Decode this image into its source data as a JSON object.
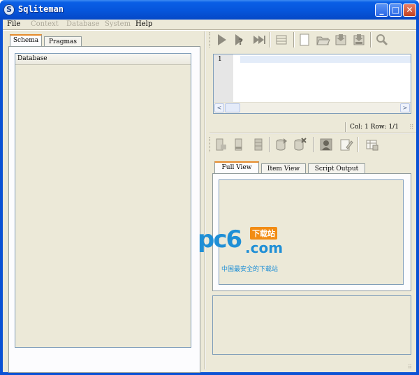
{
  "window": {
    "title": "Sqliteman",
    "icon": "app-logo-icon"
  },
  "menubar": [
    {
      "label": "File",
      "enabled": true
    },
    {
      "label": "Context",
      "enabled": false
    },
    {
      "label": "Database",
      "enabled": false
    },
    {
      "label": "System",
      "enabled": false
    },
    {
      "label": "Help",
      "enabled": true
    }
  ],
  "left": {
    "tabs": [
      "Schema",
      "Pragmas"
    ],
    "active_tab": "Schema",
    "tree_header": "Database"
  },
  "sql_toolbar": [
    "run-sql-icon",
    "explain-icon",
    "run-script-icon",
    "run-explain-icon",
    "new-file-icon",
    "open-file-icon",
    "save-file-icon",
    "save-as-icon",
    "search-icon"
  ],
  "editor": {
    "line_number": "1",
    "text": ""
  },
  "cursor_status": "Col: 1 Row: 1/1",
  "data_toolbar": [
    "insert-row-icon",
    "delete-row-icon",
    "commit-icon",
    "export-icon",
    "remove-icon",
    "blob-preview-icon",
    "edit-blob-icon",
    "table-edit-icon"
  ],
  "result_tabs": [
    "Full View",
    "Item View",
    "Script Output"
  ],
  "active_result_tab": "Full View",
  "watermark": {
    "brand": "pc6",
    "badge": "下载站",
    "domain": ".com",
    "tagline": "中国最安全的下载站"
  }
}
